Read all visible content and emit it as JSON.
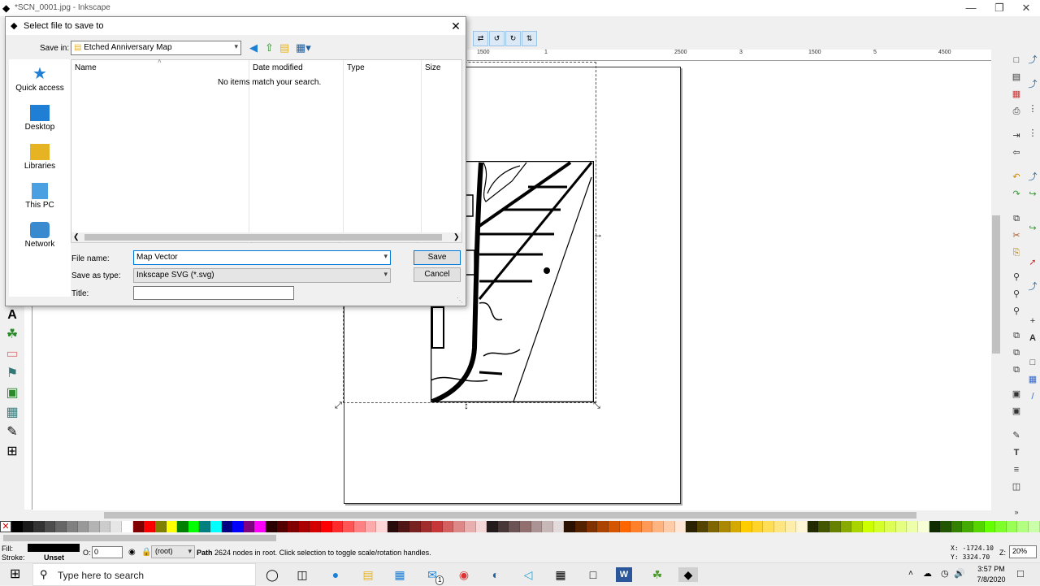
{
  "window": {
    "title": "*SCN_0001.jpg - Inkscape",
    "min": "—",
    "max": "❐",
    "close": "✕"
  },
  "ruler": {
    "top_ticks": [
      "1500",
      "1",
      "2500",
      "3",
      "1500",
      "5",
      "4500"
    ]
  },
  "dialog": {
    "title": "Select file to save to",
    "save_in_label": "Save in:",
    "save_in_value": "Etched Anniversary Map",
    "places": [
      {
        "label": "Quick access",
        "icon": "star-icon"
      },
      {
        "label": "Desktop",
        "icon": "desktop-icon"
      },
      {
        "label": "Libraries",
        "icon": "libraries-icon"
      },
      {
        "label": "This PC",
        "icon": "computer-icon"
      },
      {
        "label": "Network",
        "icon": "network-icon"
      }
    ],
    "columns": [
      "Name",
      "Date modified",
      "Type",
      "Size"
    ],
    "empty_message": "No items match your search.",
    "file_name_label": "File name:",
    "file_name_value": "Map Vector",
    "save_as_type_label": "Save as type:",
    "save_as_type_value": "Inkscape SVG (*.svg)",
    "title_label": "Title:",
    "title_value": "",
    "save_button": "Save",
    "cancel_button": "Cancel"
  },
  "status": {
    "fill_label": "Fill:",
    "stroke_label": "Stroke:",
    "stroke_value": "Unset",
    "opacity_label": "O:",
    "opacity_value": "0",
    "layer_value": "(root)",
    "message_bold": "Path",
    "message": " 2624 nodes in root. Click selection to toggle scale/rotation handles.",
    "x_coord": "X: -1724.10",
    "y_coord": "Y: 3324.70",
    "zoom_label": "Z:",
    "zoom_value": "20%"
  },
  "taskbar": {
    "search_placeholder": "Type here to search",
    "time": "3:57 PM",
    "date": "7/8/2020",
    "mail_badge": "1"
  },
  "palette": [
    "#000000",
    "#1a1a1a",
    "#333333",
    "#4d4d4d",
    "#666666",
    "#808080",
    "#999999",
    "#b3b3b3",
    "#cccccc",
    "#e6e6e6",
    "#ffffff",
    "#800000",
    "#ff0000",
    "#808000",
    "#ffff00",
    "#008000",
    "#00ff00",
    "#008080",
    "#00ffff",
    "#000080",
    "#0000ff",
    "#800080",
    "#ff00ff",
    "#2b0000",
    "#550000",
    "#800000",
    "#aa0000",
    "#d40000",
    "#ff0000",
    "#ff2a2a",
    "#ff5555",
    "#ff8080",
    "#ffaaaa",
    "#ffd5d5",
    "#280b0b",
    "#501616",
    "#782121",
    "#a02c2c",
    "#c83737",
    "#d35f5f",
    "#de8787",
    "#e9afaf",
    "#f4d7d7",
    "#241c1c",
    "#483737",
    "#6c5353",
    "#916f6f",
    "#ac9393",
    "#c8b7b7",
    "#e3dbdb",
    "#2b1100",
    "#552200",
    "#803300",
    "#aa4400",
    "#d45500",
    "#ff6600",
    "#ff7f2a",
    "#ff9955",
    "#ffb380",
    "#ffccaa",
    "#ffe6d5",
    "#2b2200",
    "#554400",
    "#806600",
    "#aa8800",
    "#d4aa00",
    "#ffcc00",
    "#ffd42a",
    "#ffdd55",
    "#ffe680",
    "#ffeeaa",
    "#fff6d5",
    "#222b00",
    "#445500",
    "#668000",
    "#88aa00",
    "#aad400",
    "#ccff00",
    "#d4ff2a",
    "#ddff55",
    "#e5ff80",
    "#eeffaa",
    "#f6ffd5",
    "#112b00",
    "#225500",
    "#338000",
    "#44aa00",
    "#55d400",
    "#66ff00",
    "#7fff2a",
    "#99ff55",
    "#b3ff80",
    "#ccffaa"
  ]
}
